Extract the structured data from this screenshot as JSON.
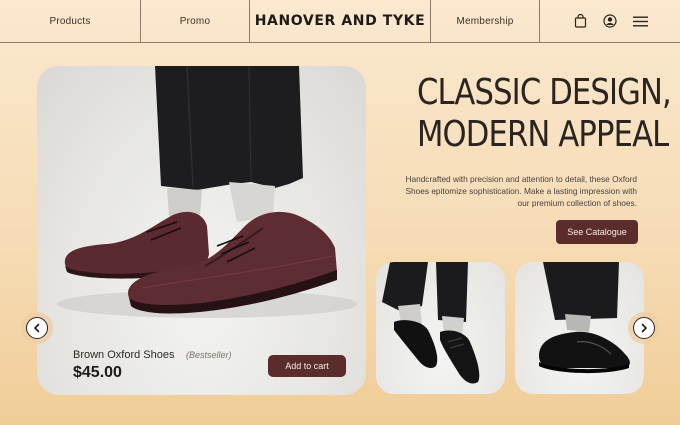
{
  "nav": {
    "products": "Products",
    "promo": "Promo",
    "brand": "HANOVER AND TYKE",
    "membership": "Membership",
    "icons": [
      "shopping-bag-icon",
      "user-account-icon",
      "hamburger-menu-icon"
    ]
  },
  "hero": {
    "headline_line1": "CLASSIC DESIGN,",
    "headline_line2": "MODERN APPEAL",
    "description": "Handcrafted with precision and attention to detail, these Oxford Shoes epitomize sophistication. Make a lasting impression with our premium collection of shoes.",
    "cta_label": "See Catalogue"
  },
  "product": {
    "name": "Brown Oxford Shoes",
    "tag": "(Bestseller)",
    "price": "$45.00",
    "add_to_cart_label": "Add to cart"
  },
  "carousel": {
    "prev_icon": "chevron-left-icon",
    "next_icon": "chevron-right-icon"
  },
  "thumbnails": [
    {
      "description_icon": "black-oxford-shoe-image"
    },
    {
      "description_icon": "black-loafer-shoe-image"
    }
  ],
  "colors": {
    "accent": "#5a2c2c",
    "background_top": "#fbe8cf",
    "background_bottom": "#f0cd98",
    "text_dark": "#2a2420"
  }
}
